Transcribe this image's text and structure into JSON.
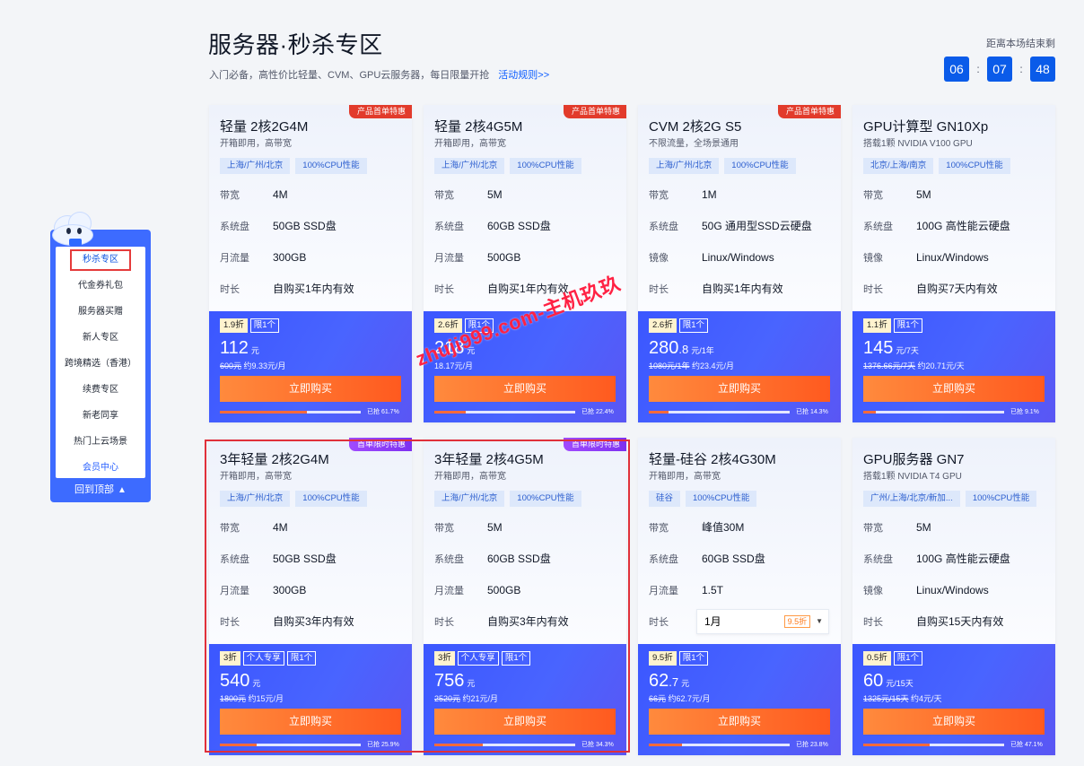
{
  "header": {
    "title": "服务器·秒杀专区",
    "subtitle": "入门必备，高性价比轻量、CVM、GPU云服务器，每日限量开抢",
    "rules_link": "活动规则>>"
  },
  "countdown": {
    "label": "距离本场结束剩",
    "hours": "06",
    "minutes": "07",
    "seconds": "48",
    "sep": ":"
  },
  "side_nav": {
    "items": [
      {
        "label": "秒杀专区",
        "active": true
      },
      {
        "label": "代金券礼包"
      },
      {
        "label": "服务器买赠"
      },
      {
        "label": "新人专区"
      },
      {
        "label": "跨境精选（香港）"
      },
      {
        "label": "续费专区"
      },
      {
        "label": "新老同享"
      },
      {
        "label": "热门上云场景"
      },
      {
        "label": "会员中心"
      }
    ],
    "back_top": "回到顶部",
    "back_top_icon": "chevron-up-icon"
  },
  "watermark": "zhuji999.com-主机玖玖",
  "colors": {
    "accent": "#0a5be9",
    "card_bottom": "#4964ff",
    "buy_button": "#ff6a2a",
    "ribbon_red": "#e23b2b",
    "ribbon_purple": "#8a38f5",
    "highlight": "#e0303a"
  },
  "cards": [
    {
      "ribbon": "产品首单特惠",
      "ribbon_color": "red",
      "title": "轻量 2核2G4M",
      "subtitle": "开箱即用，高带宽",
      "tags": [
        "上海/广州/北京",
        "100%CPU性能"
      ],
      "specs": [
        {
          "k": "带宽",
          "v": "4M"
        },
        {
          "k": "系统盘",
          "v": "50GB SSD盘"
        },
        {
          "k": "月流量",
          "v": "300GB"
        },
        {
          "k": "时长",
          "v": "自购买1年内有效"
        }
      ],
      "badges": [
        "1.9折",
        "限1个"
      ],
      "price": "112",
      "price_dec": "",
      "unit": "元",
      "orig": "600元",
      "orig_note": " 约9.33元/月",
      "buy": "立即购买",
      "progress": 61.7,
      "progress_text": "已抢 61.7%"
    },
    {
      "ribbon": "产品首单特惠",
      "ribbon_color": "red",
      "title": "轻量 2核4G5M",
      "subtitle": "开箱即用，高带宽",
      "tags": [
        "上海/广州/北京",
        "100%CPU性能"
      ],
      "specs": [
        {
          "k": "带宽",
          "v": "5M"
        },
        {
          "k": "系统盘",
          "v": "60GB SSD盘"
        },
        {
          "k": "月流量",
          "v": "500GB"
        },
        {
          "k": "时长",
          "v": "自购买1年内有效"
        }
      ],
      "badges": [
        "2.6折",
        "限1个"
      ],
      "price": "218",
      "price_dec": "",
      "unit": "元",
      "orig": "",
      "orig_note": "18.17元/月",
      "buy": "立即购买",
      "progress": 22.4,
      "progress_text": "已抢 22.4%"
    },
    {
      "ribbon": "产品首单特惠",
      "ribbon_color": "red",
      "title": "CVM 2核2G S5",
      "subtitle": "不限流量，全场景通用",
      "tags": [
        "上海/广州/北京",
        "100%CPU性能"
      ],
      "specs": [
        {
          "k": "带宽",
          "v": "1M"
        },
        {
          "k": "系统盘",
          "v": "50G 通用型SSD云硬盘"
        },
        {
          "k": "镜像",
          "v": "Linux/Windows"
        },
        {
          "k": "时长",
          "v": "自购买1年内有效"
        }
      ],
      "badges": [
        "2.6折",
        "限1个"
      ],
      "price": "280",
      "price_dec": ".8",
      "unit": "元/1年",
      "orig": "1080元/1年",
      "orig_note": " 约23.4元/月",
      "buy": "立即购买",
      "progress": 14.3,
      "progress_text": "已抢 14.3%"
    },
    {
      "ribbon": "",
      "ribbon_color": "",
      "title": "GPU计算型 GN10Xp",
      "subtitle": "搭载1颗 NVIDIA V100 GPU",
      "tags": [
        "北京/上海/南京",
        "100%CPU性能"
      ],
      "specs": [
        {
          "k": "带宽",
          "v": "5M"
        },
        {
          "k": "系统盘",
          "v": "100G 高性能云硬盘"
        },
        {
          "k": "镜像",
          "v": "Linux/Windows"
        },
        {
          "k": "时长",
          "v": "自购买7天内有效"
        }
      ],
      "badges": [
        "1.1折",
        "限1个"
      ],
      "price": "145",
      "price_dec": "",
      "unit": "元/7天",
      "orig": "1376.66元/7天",
      "orig_note": " 约20.71元/天",
      "buy": "立即购买",
      "progress": 9.1,
      "progress_text": "已抢 9.1%"
    },
    {
      "ribbon": "首单限时特惠",
      "ribbon_color": "purple",
      "title": "3年轻量 2核2G4M",
      "subtitle": "开箱即用，高带宽",
      "tags": [
        "上海/广州/北京",
        "100%CPU性能"
      ],
      "specs": [
        {
          "k": "带宽",
          "v": "4M"
        },
        {
          "k": "系统盘",
          "v": "50GB SSD盘"
        },
        {
          "k": "月流量",
          "v": "300GB"
        },
        {
          "k": "时长",
          "v": "自购买3年内有效"
        }
      ],
      "badges": [
        "3折",
        "个人专享",
        "限1个"
      ],
      "price": "540",
      "price_dec": "",
      "unit": "元",
      "orig": "1800元",
      "orig_note": " 约15元/月",
      "buy": "立即购买",
      "progress": 25.9,
      "progress_text": "已抢 25.9%"
    },
    {
      "ribbon": "首单限时特惠",
      "ribbon_color": "purple",
      "title": "3年轻量 2核4G5M",
      "subtitle": "开箱即用，高带宽",
      "tags": [
        "上海/广州/北京",
        "100%CPU性能"
      ],
      "specs": [
        {
          "k": "带宽",
          "v": "5M"
        },
        {
          "k": "系统盘",
          "v": "60GB SSD盘"
        },
        {
          "k": "月流量",
          "v": "500GB"
        },
        {
          "k": "时长",
          "v": "自购买3年内有效"
        }
      ],
      "badges": [
        "3折",
        "个人专享",
        "限1个"
      ],
      "price": "756",
      "price_dec": "",
      "unit": "元",
      "orig": "2520元",
      "orig_note": " 约21元/月",
      "buy": "立即购买",
      "progress": 34.3,
      "progress_text": "已抢 34.3%"
    },
    {
      "ribbon": "",
      "ribbon_color": "",
      "title": "轻量-硅谷 2核4G30M",
      "subtitle": "开箱即用，高带宽",
      "tags": [
        "硅谷",
        "100%CPU性能"
      ],
      "specs": [
        {
          "k": "带宽",
          "v": "峰值30M"
        },
        {
          "k": "系统盘",
          "v": "60GB SSD盘"
        },
        {
          "k": "月流量",
          "v": "1.5T"
        },
        {
          "k": "时长",
          "v": "1月",
          "select": true,
          "select_disc": "9.5折"
        }
      ],
      "badges": [
        "9.5折",
        "限1个"
      ],
      "price": "62",
      "price_dec": ".7",
      "unit": "元",
      "orig": "66元",
      "orig_note": " 约62.7元/月",
      "buy": "立即购买",
      "progress": 23.8,
      "progress_text": "已抢 23.8%"
    },
    {
      "ribbon": "",
      "ribbon_color": "",
      "title": "GPU服务器 GN7",
      "subtitle": "搭载1颗 NVIDIA T4 GPU",
      "tags": [
        "广州/上海/北京/新加...",
        "100%CPU性能"
      ],
      "specs": [
        {
          "k": "带宽",
          "v": "5M"
        },
        {
          "k": "系统盘",
          "v": "100G 高性能云硬盘"
        },
        {
          "k": "镜像",
          "v": "Linux/Windows"
        },
        {
          "k": "时长",
          "v": "自购买15天内有效"
        }
      ],
      "badges": [
        "0.5折",
        "限1个"
      ],
      "price": "60",
      "price_dec": "",
      "unit": "元/15天",
      "orig": "1325元/15天",
      "orig_note": " 约4元/天",
      "buy": "立即购买",
      "progress": 47.1,
      "progress_text": "已抢 47.1%"
    }
  ]
}
